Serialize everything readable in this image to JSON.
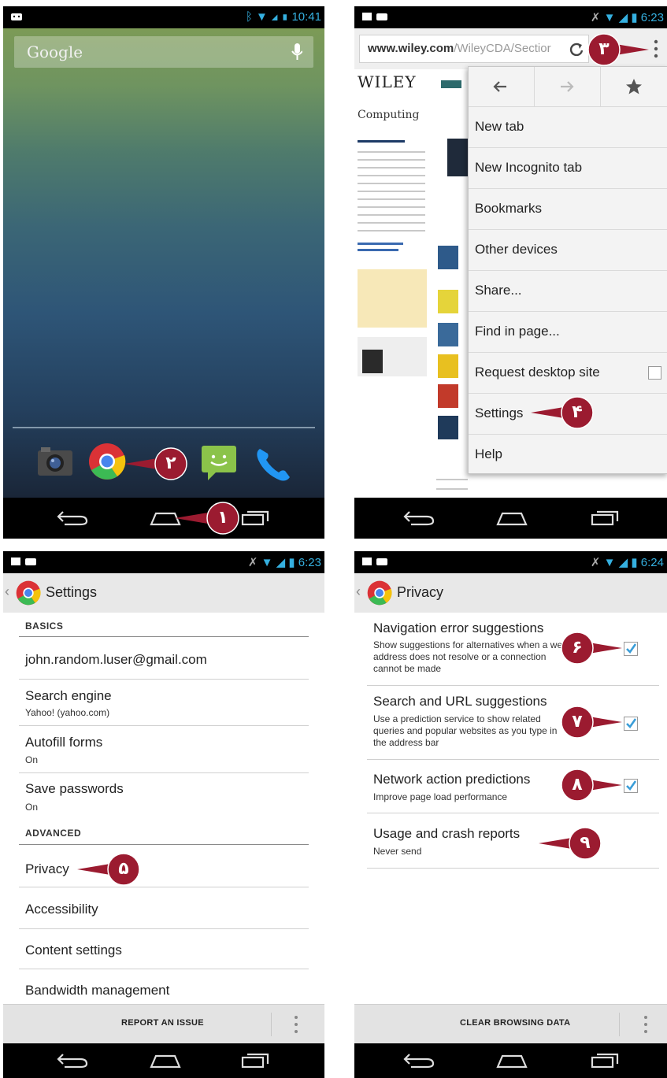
{
  "colors": {
    "callout": "#9b1b30",
    "accent_blue": "#35b0e0",
    "checkbox_blue": "#3a9dd8"
  },
  "panel1": {
    "status_time": "10:41",
    "search_label": "Google",
    "dock_icons": [
      "camera-icon",
      "chrome-icon",
      "messaging-icon",
      "phone-icon"
    ],
    "callouts": [
      "١",
      "٢"
    ]
  },
  "panel2": {
    "status_time": "6:23",
    "url_domain": "www.wiley.com",
    "url_path": "/WileyCDA/Sectior",
    "page_logo": "WILEY",
    "page_heading": "Computing",
    "menu_items": [
      "New tab",
      "New Incognito tab",
      "Bookmarks",
      "Other devices",
      "Share...",
      "Find in page...",
      "Request desktop site",
      "Settings",
      "Help"
    ],
    "request_desktop_checked": false,
    "callouts": [
      "٣",
      "۴"
    ]
  },
  "panel3": {
    "status_time": "6:23",
    "title": "Settings",
    "basics_header": "BASICS",
    "account": "john.random.luser@gmail.com",
    "search_engine_title": "Search engine",
    "search_engine_value": "Yahoo! (yahoo.com)",
    "autofill_title": "Autofill forms",
    "autofill_value": "On",
    "passwords_title": "Save passwords",
    "passwords_value": "On",
    "advanced_header": "ADVANCED",
    "privacy": "Privacy",
    "accessibility": "Accessibility",
    "content_settings": "Content settings",
    "bandwidth": "Bandwidth management",
    "bottom_button": "REPORT AN ISSUE",
    "callout": "۵"
  },
  "panel4": {
    "status_time": "6:24",
    "title": "Privacy",
    "items": [
      {
        "title": "Navigation error suggestions",
        "sub": "Show suggestions for alternatives when a web address does not resolve or a connection cannot be made",
        "checked": true
      },
      {
        "title": "Search and URL suggestions",
        "sub": "Use a prediction service to show related queries and popular websites as you type in the address bar",
        "checked": true
      },
      {
        "title": "Network action predictions",
        "sub": "Improve page load performance",
        "checked": true
      },
      {
        "title": "Usage and crash reports",
        "sub": "Never send",
        "checked": null
      }
    ],
    "bottom_button": "CLEAR BROWSING DATA",
    "callouts": [
      "۶",
      "٧",
      "٨",
      "٩"
    ]
  }
}
